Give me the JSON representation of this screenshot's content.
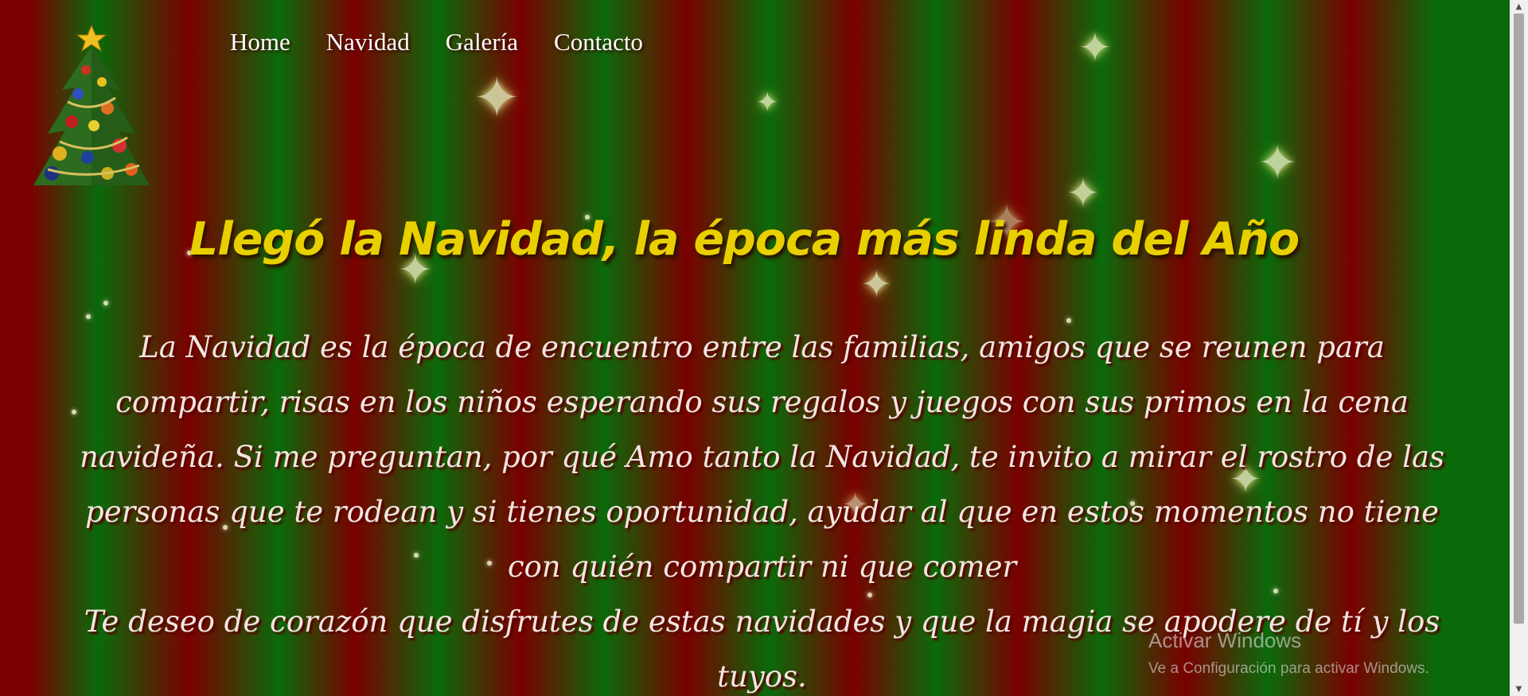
{
  "nav": {
    "items": [
      {
        "label": "Home"
      },
      {
        "label": "Navidad"
      },
      {
        "label": "Galería"
      },
      {
        "label": "Contacto"
      }
    ]
  },
  "main": {
    "headline": "Llegó la Navidad, la época más linda del Año",
    "paragraph1": "La Navidad es la época de encuentro entre las familias, amigos que se reunen para compartir, risas en los niños esperando sus regalos y juegos con sus primos en la cena navideña. Si me preguntan, por qué Amo tanto la Navidad, te invito a mirar el rostro de las personas que te rodean y si tienes oportunidad, ayudar al que en estos momentos no tiene con quién compartir ni que comer",
    "paragraph2": "Te deseo de corazón que disfrutes de estas navidades y que la magia se apodere de tí y los tuyos."
  },
  "watermark": {
    "title": "Activar Windows",
    "subtitle": "Ve a Configuración para activar Windows."
  },
  "icons": {
    "logo": "christmas-tree-icon",
    "decorations": "star-icon"
  },
  "colors": {
    "red": "#7a0000",
    "green": "#0a6a0a",
    "headline": "#e8d000",
    "body_text": "#f2e6e0"
  }
}
